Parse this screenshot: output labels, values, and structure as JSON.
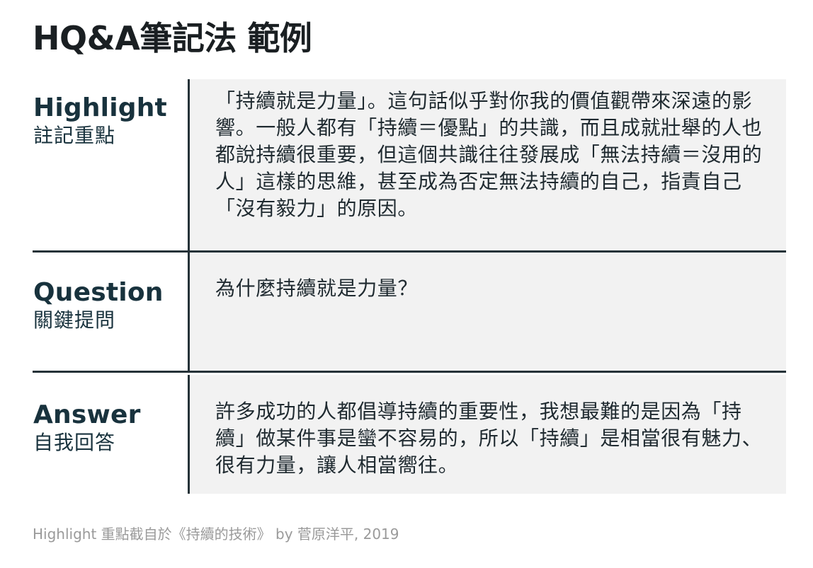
{
  "title": "HQ&A筆記法 範例",
  "rows": [
    {
      "label_en": "Highlight",
      "label_zh": "註記重點",
      "content": "「持續就是力量」。這句話似乎對你我的價值觀帶來深遠的影響。一般人都有「持續＝優點」的共識，而且成就壯舉的人也都說持續很重要，但這個共識往往發展成「無法持續＝沒用的人」這樣的思維，甚至成為否定無法持續的自己，指責自己「沒有毅力」的原因。"
    },
    {
      "label_en": "Question",
      "label_zh": "關鍵提問",
      "content": "為什麼持續就是力量？"
    },
    {
      "label_en": "Answer",
      "label_zh": "自我回答",
      "content": "許多成功的人都倡導持續的重要性，我想最難的是因為「持續」做某件事是蠻不容易的，所以「持續」是相當很有魅力、很有力量，讓人相當嚮往。"
    }
  ],
  "footer": "Highlight 重點截自於《持續的技術》 by 菅原洋平, 2019",
  "colors": {
    "rule": "#253238",
    "cell_background": "#f2f2f2",
    "label_text": "#18323d",
    "footer_text": "#9a9a9a"
  }
}
